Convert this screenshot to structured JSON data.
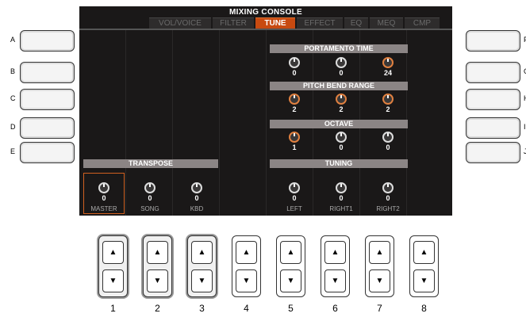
{
  "screen": {
    "title": "MIXING CONSOLE",
    "tabs": [
      "VOL/VOICE",
      "FILTER",
      "TUNE",
      "EFFECT",
      "EQ",
      "MEQ",
      "CMP"
    ],
    "active_tab": "TUNE"
  },
  "side_buttons": {
    "left": [
      "A",
      "B",
      "C",
      "D",
      "E"
    ],
    "right": [
      "F",
      "G",
      "H",
      "I",
      "J"
    ]
  },
  "sections": {
    "transpose": "TRANSPOSE",
    "portamento": "PORTAMENTO TIME",
    "pitch_bend": "PITCH BEND RANGE",
    "octave": "OCTAVE",
    "tuning": "TUNING"
  },
  "values": {
    "portamento": [
      "0",
      "0",
      "24"
    ],
    "pitch_bend": [
      "2",
      "2",
      "2"
    ],
    "octave": [
      "1",
      "0",
      "0"
    ],
    "transpose": [
      "0",
      "0",
      "0"
    ],
    "tuning": [
      "0",
      "0",
      "0"
    ]
  },
  "columns": [
    "MASTER",
    "SONG",
    "KBD",
    "",
    "LEFT",
    "RIGHT1",
    "RIGHT2",
    ""
  ],
  "updown_numbers": [
    "1",
    "2",
    "3",
    "4",
    "5",
    "6",
    "7",
    "8"
  ],
  "icons": {
    "up": "▲",
    "down": "▼"
  }
}
